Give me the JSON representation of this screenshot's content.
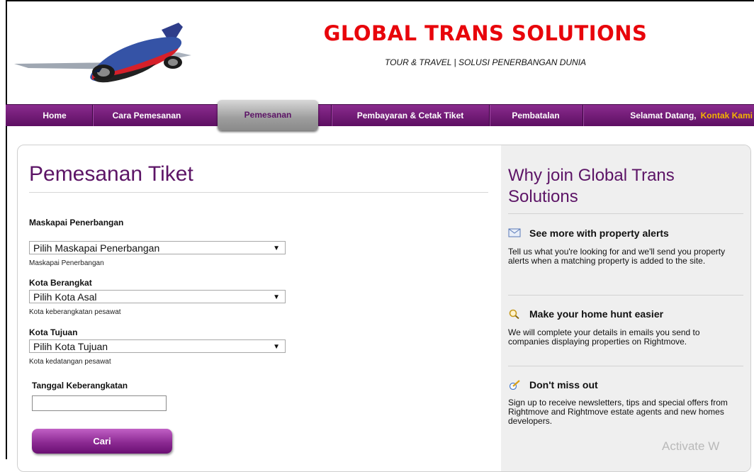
{
  "header": {
    "site_title": "GLOBAL TRANS SOLUTIONS",
    "tagline": "TOUR & TRAVEL | SOLUSI PENERBANGAN DUNIA"
  },
  "nav": {
    "items": [
      "Home",
      "Cara Pemesanan",
      "Pemesanan",
      "Pembayaran & Cetak Tiket",
      "Pembatalan"
    ],
    "active": "Pemesanan",
    "welcome": "Selamat Datang,",
    "contact": "Kontak Kami"
  },
  "form": {
    "title": "Pemesanan Tiket",
    "airline_label": "Maskapai Penerbangan",
    "airline_value": "Pilih Maskapai Penerbangan",
    "airline_hint": "Maskapai Penerbangan",
    "origin_label": "Kota Berangkat",
    "origin_value": "Pilih Kota Asal",
    "origin_hint": "Kota keberangkatan pesawat",
    "dest_label": "Kota Tujuan",
    "dest_value": "Pilih Kota Tujuan",
    "dest_hint": "Kota kedatangan pesawat",
    "date_label": "Tanggal Keberangkatan",
    "date_value": "",
    "submit_label": "Cari"
  },
  "panel": {
    "title": "Why join Global Trans Solutions",
    "perks": [
      {
        "heading": "See more with property alerts",
        "icon": "envelope-icon",
        "text": "Tell us what you're looking for and we'll send you property alerts when a matching property is added to the site."
      },
      {
        "heading": "Make your home hunt easier",
        "icon": "magnifier-icon",
        "text": "We will complete your details in emails you send to companies displaying properties on Rightmove."
      },
      {
        "heading": "Don't miss out",
        "icon": "newsletter-icon",
        "text": "Sign up to receive newsletters, tips and special offers from Rightmove and Rightmove estate agents and new homes developers."
      }
    ]
  },
  "watermark": "Activate W",
  "colors": {
    "brand_red": "#e8050b",
    "nav_purple": "#5d0f62",
    "accent_purple": "#5c1466",
    "link_gold": "#f4b400"
  }
}
